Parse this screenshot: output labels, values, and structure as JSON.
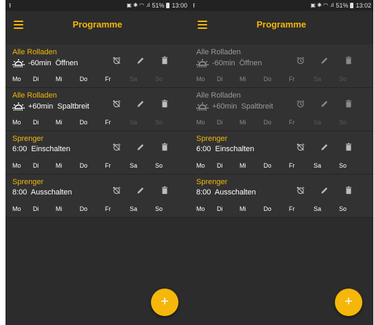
{
  "colors": {
    "accent": "#f5b70a",
    "background": "#2c2c2c",
    "card": "#323232",
    "inactive_text": "#9a9a9a",
    "disabled_day": "#5a5a5a"
  },
  "icons": {
    "menu": "menu-icon",
    "sun": "sun-icon",
    "alarm_off": "alarm-off-icon",
    "alarm": "alarm-icon",
    "edit": "pencil-icon",
    "delete": "trash-icon",
    "add": "plus-icon",
    "upload": "upload-icon"
  },
  "screens": [
    {
      "status": {
        "left_icon": "⭱",
        "signal": "51%",
        "time": "13:00"
      },
      "title": "Programme",
      "fab_label": "+",
      "items": [
        {
          "name": "Alle Rolladen",
          "action": "-60min  Öffnen",
          "active": true,
          "alarm": "off",
          "days": [
            {
              "label": "Mo",
              "on": true
            },
            {
              "label": "Di",
              "on": true
            },
            {
              "label": "Mi",
              "on": true
            },
            {
              "label": "Do",
              "on": true
            },
            {
              "label": "Fr",
              "on": true
            },
            {
              "label": "Sa",
              "on": false
            },
            {
              "label": "So",
              "on": false
            }
          ]
        },
        {
          "name": "Alle Rolladen",
          "action": "+60min  Spaltbreit",
          "active": true,
          "alarm": "off",
          "days": [
            {
              "label": "Mo",
              "on": true
            },
            {
              "label": "Di",
              "on": true
            },
            {
              "label": "Mi",
              "on": true
            },
            {
              "label": "Do",
              "on": true
            },
            {
              "label": "Fr",
              "on": true
            },
            {
              "label": "Sa",
              "on": false
            },
            {
              "label": "So",
              "on": false
            }
          ]
        },
        {
          "name": "Sprenger",
          "action": "6:00  Einschalten",
          "active": true,
          "alarm": "off",
          "days": [
            {
              "label": "Mo",
              "on": true
            },
            {
              "label": "Di",
              "on": true
            },
            {
              "label": "Mi",
              "on": true
            },
            {
              "label": "Do",
              "on": true
            },
            {
              "label": "Fr",
              "on": true
            },
            {
              "label": "Sa",
              "on": true
            },
            {
              "label": "So",
              "on": true
            }
          ]
        },
        {
          "name": "Sprenger",
          "action": "8:00  Ausschalten",
          "active": true,
          "alarm": "off",
          "days": [
            {
              "label": "Mo",
              "on": true
            },
            {
              "label": "Di",
              "on": true
            },
            {
              "label": "Mi",
              "on": true
            },
            {
              "label": "Do",
              "on": true
            },
            {
              "label": "Fr",
              "on": true
            },
            {
              "label": "Sa",
              "on": true
            },
            {
              "label": "So",
              "on": true
            }
          ]
        }
      ]
    },
    {
      "status": {
        "left_icon": "⭱",
        "signal": "51%",
        "time": "13:02"
      },
      "title": "Programme",
      "fab_label": "+",
      "items": [
        {
          "name": "Alle Rolladen",
          "action": "-60min  Öffnen",
          "active": false,
          "alarm": "on",
          "days": [
            {
              "label": "Mo",
              "on": true
            },
            {
              "label": "Di",
              "on": true
            },
            {
              "label": "Mi",
              "on": true
            },
            {
              "label": "Do",
              "on": true
            },
            {
              "label": "Fr",
              "on": true
            },
            {
              "label": "Sa",
              "on": false
            },
            {
              "label": "So",
              "on": false
            }
          ]
        },
        {
          "name": "Alle Rolladen",
          "action": "+60min  Spaltbreit",
          "active": false,
          "alarm": "on",
          "days": [
            {
              "label": "Mo",
              "on": true
            },
            {
              "label": "Di",
              "on": true
            },
            {
              "label": "Mi",
              "on": true
            },
            {
              "label": "Do",
              "on": true
            },
            {
              "label": "Fr",
              "on": true
            },
            {
              "label": "Sa",
              "on": false
            },
            {
              "label": "So",
              "on": false
            }
          ]
        },
        {
          "name": "Sprenger",
          "action": "6:00  Einschalten",
          "active": true,
          "alarm": "off",
          "days": [
            {
              "label": "Mo",
              "on": true
            },
            {
              "label": "Di",
              "on": true
            },
            {
              "label": "Mi",
              "on": true
            },
            {
              "label": "Do",
              "on": true
            },
            {
              "label": "Fr",
              "on": true
            },
            {
              "label": "Sa",
              "on": true
            },
            {
              "label": "So",
              "on": true
            }
          ]
        },
        {
          "name": "Sprenger",
          "action": "8:00  Ausschalten",
          "active": true,
          "alarm": "off",
          "days": [
            {
              "label": "Mo",
              "on": true
            },
            {
              "label": "Di",
              "on": true
            },
            {
              "label": "Mi",
              "on": true
            },
            {
              "label": "Do",
              "on": true
            },
            {
              "label": "Fr",
              "on": true
            },
            {
              "label": "Sa",
              "on": true
            },
            {
              "label": "So",
              "on": true
            }
          ]
        }
      ]
    }
  ]
}
